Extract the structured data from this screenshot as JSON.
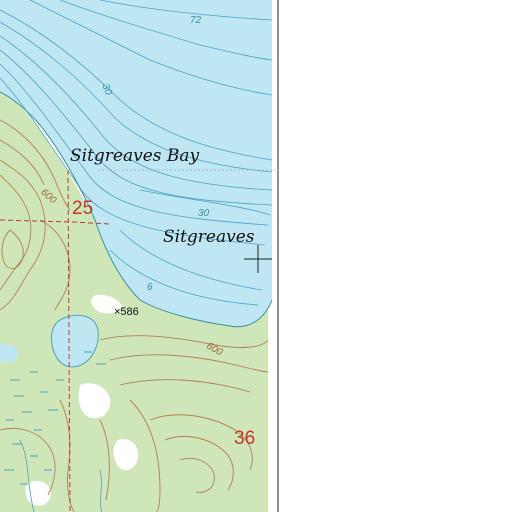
{
  "map": {
    "labels": {
      "bay_name": "Sitgreaves Bay",
      "point_name": "Sitgreaves",
      "depth_72": "72",
      "depth_30_upper": "30",
      "depth_30_lower": "30",
      "depth_6": "6",
      "contour_600_west": "600",
      "contour_600_south": "600",
      "section_25": "25",
      "section_36": "36",
      "spot_elevation": "×586"
    },
    "colors": {
      "water": "#bfe6f3",
      "land_forest": "#cfe6b8",
      "land_clearing": "#ffffff",
      "contour_land": "#b08055",
      "contour_water": "#4aa3bf",
      "section_line": "#c0392b",
      "map_edge_bg": "#ffffff"
    },
    "icons": {
      "feature_marker": "crosshair-icon",
      "marsh": "marsh-symbol-icon"
    }
  }
}
